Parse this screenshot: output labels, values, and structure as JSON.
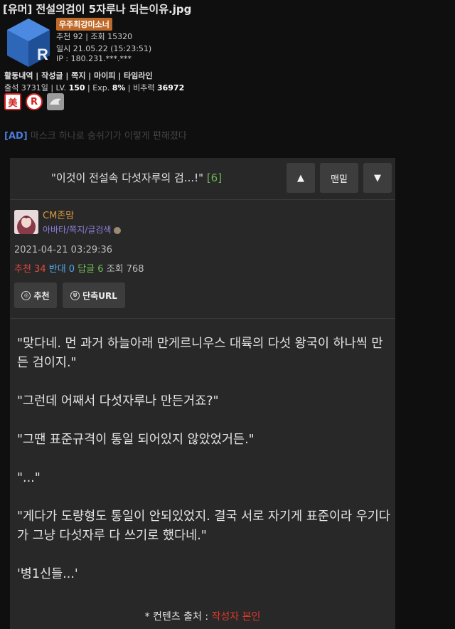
{
  "post": {
    "title": "[유머] 전설의검이 5자루나 되는이유.jpg",
    "author_badge": "우주최강미소너",
    "recommend_views": "추천 92 | 조회 15320",
    "datetime": "일시 21.05.22 (15:23:51)",
    "ip": "IP : 180.231.***.***"
  },
  "user_links": "활동내역 | 작성글 | 쪽지 | 마이피 | 타임라인",
  "user_stats": {
    "attendance": "출석 3731일 | LV.",
    "level": "150",
    "exp_label": "| Exp.",
    "exp": "8%",
    "ratio_label": "| 비추력",
    "ratio": "36972"
  },
  "ad": {
    "tag": "[AD]",
    "text": "마스크 하나로 숨쉬기가 이렇게 편해졌다"
  },
  "comment": {
    "header_title": "\"이것이 전설속 다섯자루의 검...!\"",
    "header_count": "[6]",
    "up_label": "▲",
    "bottom_label": "맨밑",
    "down_label": "▼",
    "user_name": "CM존맘",
    "user_sub": "아바타/쪽지/글검색",
    "date": "2021-04-21 03:29:36",
    "rec": "추천 34",
    "opp": "반대 0",
    "reply": "답글 6",
    "views": "조회 768",
    "rec_button": "추천",
    "url_button": "단축URL",
    "rec_icon_glyph": "◎",
    "url_icon_glyph": "U",
    "body": [
      "\"맞다네. 먼 과거 하늘아래 만게르니우스 대륙의 다섯 왕국이 하나씩 만든 검이지.\"",
      "\"그런데 어째서 다섯자루나 만든거죠?\"",
      "\"그땐 표준규격이 통일 되어있지 않았었거든.\"",
      "\"...\"",
      "\"게다가 도량형도 통일이 안되있었지. 결국 서로 자기게 표준이라 우기다가 그냥 다섯자루 다 쓰기로 했다네.\"",
      "'병1신들...'"
    ],
    "source_label": "* 컨텐츠 출처 :",
    "source_value": "작성자 본인"
  },
  "colors": {
    "background": "#0f0f10",
    "card": "#282828",
    "button": "#3d3d3d",
    "accent_orange": "#c06a2a",
    "red": "#e24a3a",
    "blue": "#4fa8e8",
    "green": "#6fbf55"
  },
  "icons": [
    "ruliweb-logo-icon",
    "medal-beauty-icon",
    "medal-r-icon",
    "medal-gray-icon",
    "up-arrow-icon",
    "down-arrow-icon",
    "recommend-icon",
    "url-icon",
    "level-dot-icon"
  ],
  "medals": {
    "medal1_text": "美",
    "medal2_text": "R"
  }
}
